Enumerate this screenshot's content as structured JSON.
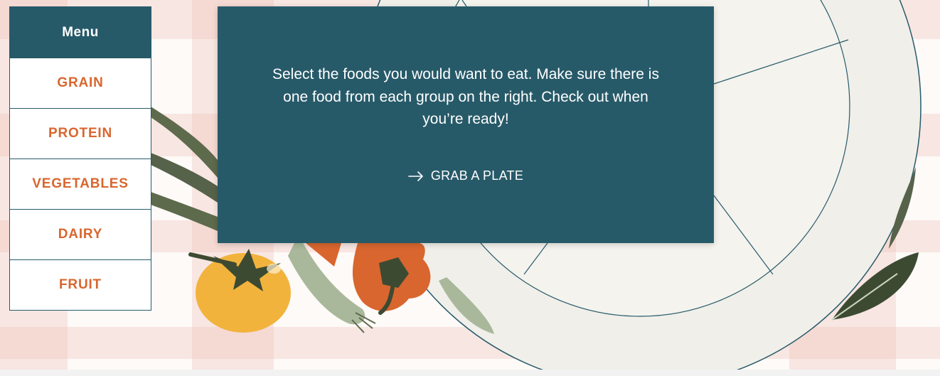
{
  "menu": {
    "title": "Menu",
    "items": [
      {
        "label": "GRAIN"
      },
      {
        "label": "PROTEIN"
      },
      {
        "label": "VEGETABLES"
      },
      {
        "label": "DAIRY"
      },
      {
        "label": "FRUIT"
      }
    ]
  },
  "intro": {
    "message": "Select the foods you would want to eat. Make sure there is one food from each group on the right. Check out when you’re ready!",
    "cta_label": "GRAB A PLATE",
    "cta_icon": "arrow-right-icon"
  },
  "colors": {
    "primary": "#275a69",
    "accent": "#d9662f",
    "plate": "#f0efe9",
    "tablecloth_stripe": "#eebeb4"
  }
}
